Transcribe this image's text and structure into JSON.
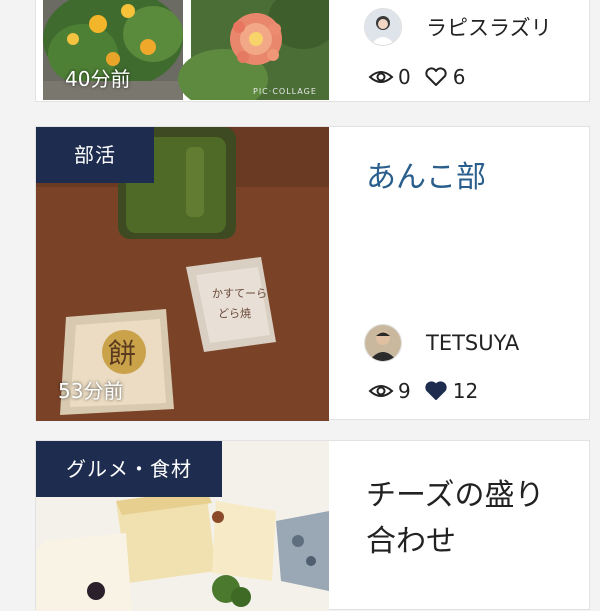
{
  "cards": [
    {
      "time_ago": "40分前",
      "collage_mark": "PIC·COLLAGE",
      "author": "ラピスラズリ",
      "views": "0",
      "likes": "6",
      "liked": false
    },
    {
      "category": "部活",
      "time_ago": "53分前",
      "title": "あんこ部",
      "author": "TETSUYA",
      "views": "9",
      "likes": "12",
      "liked": true
    },
    {
      "category": "グルメ・食材",
      "title_line1": "チーズの盛り",
      "title_line2": "合わせ"
    }
  ],
  "colors": {
    "category_bg": "#1e2d4f",
    "title_link": "#2a5e8c",
    "title_default": "#222222"
  },
  "icons": {
    "views": "eye-icon",
    "likes_outline": "heart-outline-icon",
    "likes_filled": "heart-filled-icon"
  }
}
